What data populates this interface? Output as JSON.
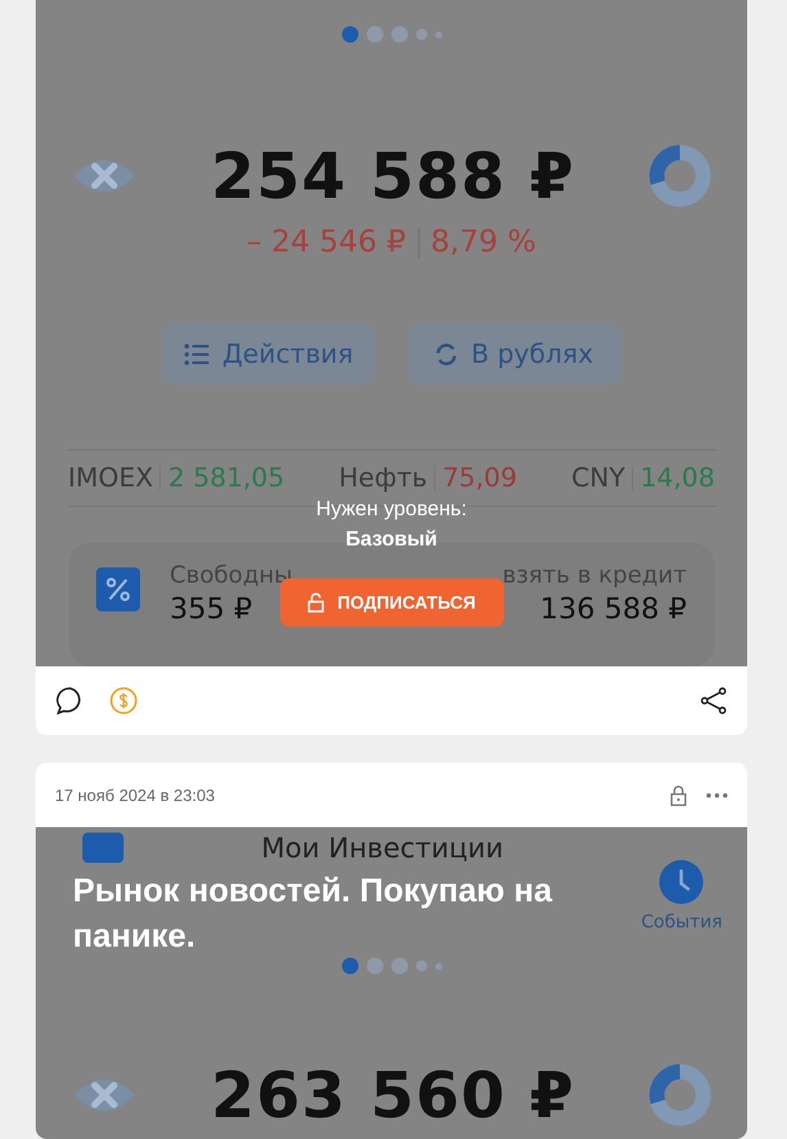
{
  "posts": [
    {
      "kind": "locked_screenshot",
      "screenshot": {
        "pager": [
          {
            "selected": true
          },
          {
            "selected": false
          },
          {
            "selected": false
          },
          {
            "selected": false
          },
          {
            "selected": false
          }
        ],
        "balance": "254 588 ₽",
        "change": "– 24 546 ₽",
        "change_percent": "8,79 %",
        "buttons": [
          {
            "label": "Действия",
            "kind": "list"
          },
          {
            "label": "В рублях",
            "kind": "convert"
          }
        ],
        "tickers": [
          {
            "name": "IMOEX",
            "value": "2 581,05",
            "color": "#2a7a4c"
          },
          {
            "name": "Нефть",
            "value": "75,09",
            "color": "#9a3b37"
          },
          {
            "name": "CNY",
            "value": "14,08",
            "color": "#2a7a4c"
          }
        ],
        "funds": [
          {
            "label": "Свободны",
            "amount": "355 ₽"
          },
          {
            "label": "взять в кредит",
            "amount": "136 588 ₽"
          }
        ]
      },
      "paywall": {
        "text": "Нужен уровень:",
        "level": "Базовый",
        "button": "ПОДПИСАТЬСЯ"
      }
    },
    {
      "kind": "titled_screenshot",
      "date": "17 нояб 2024 в 23:03",
      "locked": true,
      "title": "Рынок новостей. Покупаю на панике.",
      "screenshot": {
        "header_title": "Мои Инвестиции",
        "events_label": "События",
        "pager": [
          {
            "selected": true
          },
          {
            "selected": false
          },
          {
            "selected": false
          },
          {
            "selected": false
          },
          {
            "selected": false
          }
        ],
        "balance": "263 560 ₽"
      }
    }
  ]
}
